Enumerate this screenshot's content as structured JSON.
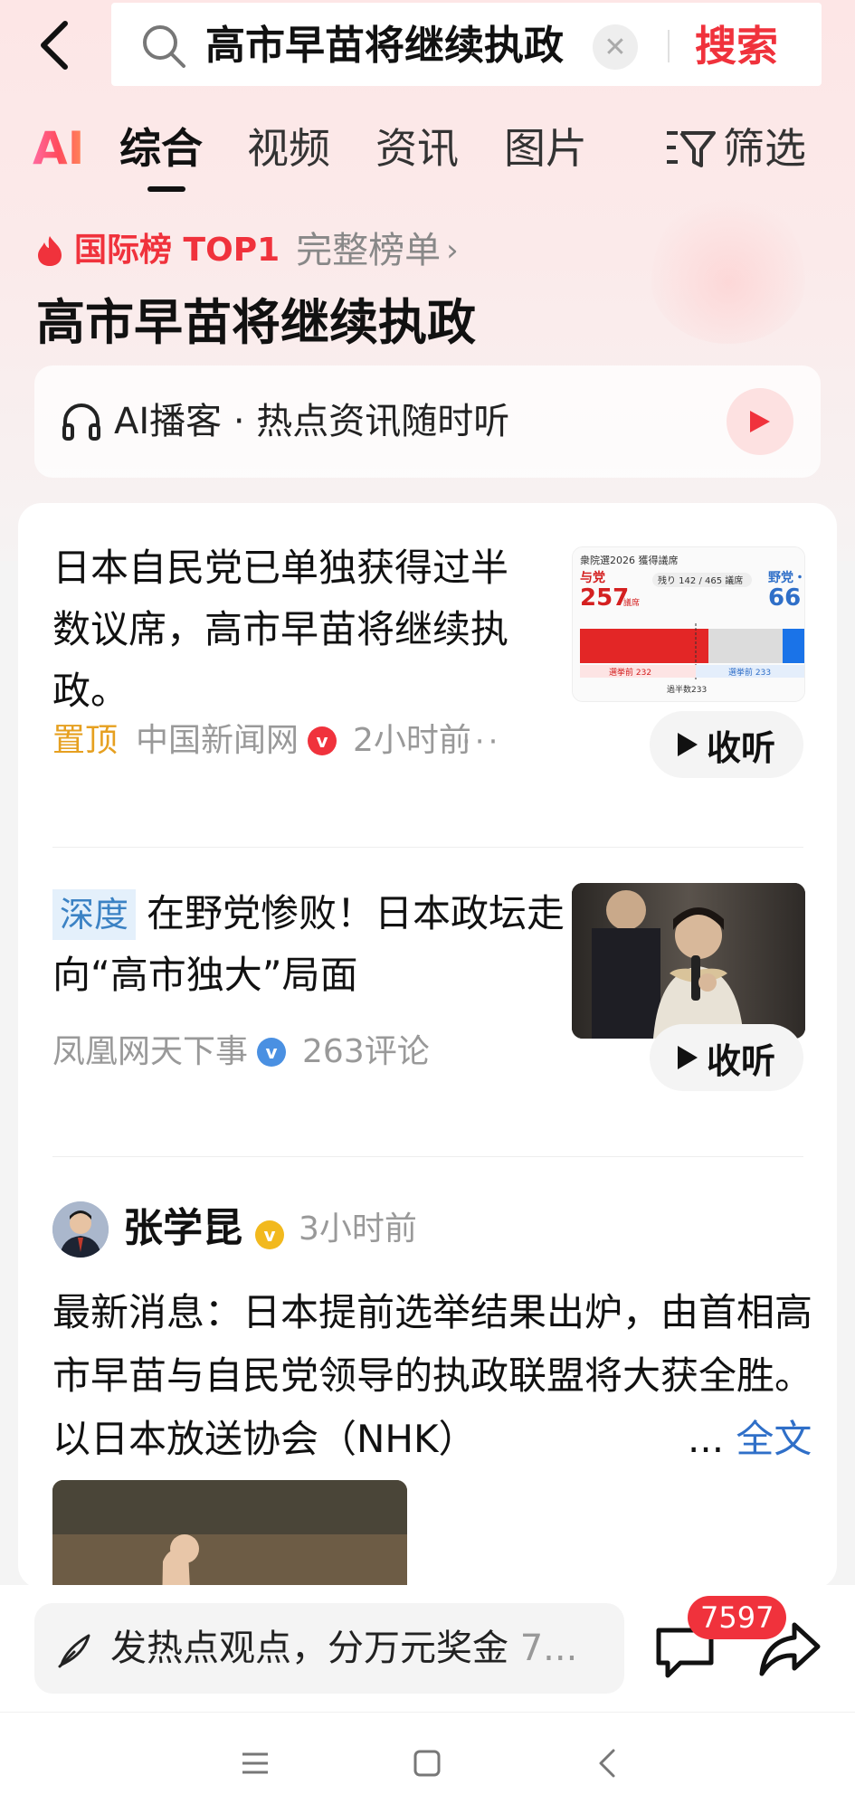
{
  "search": {
    "query": "高市早苗将继续执政",
    "submit_label": "搜索"
  },
  "tabs": {
    "ai_label": "AI",
    "items": [
      {
        "label": "综合"
      },
      {
        "label": "视频"
      },
      {
        "label": "资讯"
      },
      {
        "label": "图片"
      }
    ],
    "filter_label": "筛选"
  },
  "hot": {
    "rank_label": "国际榜 TOP1",
    "full_list_label": "完整榜单",
    "headline": "高市早苗将继续执政"
  },
  "podcast": {
    "label": "AI播客 · 热点资讯随时听"
  },
  "news": [
    {
      "title": "日本自民党已单独获得过半数议席，高市早苗将继续执政。",
      "pin_label": "置顶",
      "source": "中国新闻网",
      "time": "2小时前",
      "listen_label": "收听",
      "thumb": {
        "title": "衆院選2026 獲得議席",
        "left_party": "与党",
        "left_value": "257",
        "left_unit": "議席",
        "remaining": "残り 142 / 465 議席",
        "right_party": "野党・",
        "right_value": "66",
        "before_left": "選挙前 232",
        "before_right": "選挙前 233",
        "majority": "過半数233"
      }
    },
    {
      "tag": "深度",
      "title": "在野党惨败！日本政坛走向“高市独大”局面",
      "source": "凤凰网天下事",
      "comments": "263评论",
      "listen_label": "收听"
    }
  ],
  "post": {
    "author": "张学昆",
    "time": "3小时前",
    "body": "最新消息：日本提前选举结果出炉，由首相高市早苗与自民党领导的执政联盟将大获全胜。以日本放送协会（NHK）",
    "more_prefix": "...",
    "more_label": "全文"
  },
  "bottom": {
    "comment_placeholder": "发热点观点，分万元奖金",
    "comment_suffix": "7...",
    "comment_count": "7597"
  },
  "colors": {
    "brand_red": "#f0323c",
    "pin_gold": "#e6a020",
    "link_blue": "#2f6fc8"
  }
}
